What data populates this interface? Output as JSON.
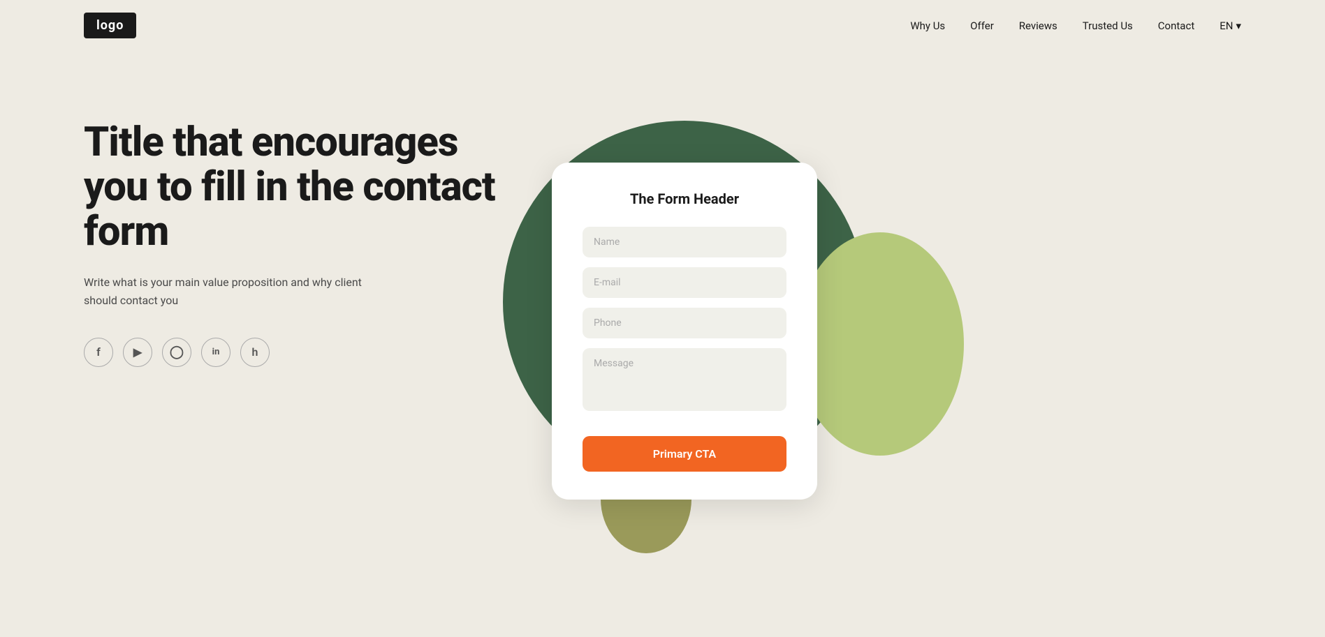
{
  "header": {
    "logo": "logo",
    "nav": {
      "items": [
        {
          "label": "Why Us",
          "href": "#"
        },
        {
          "label": "Offer",
          "href": "#"
        },
        {
          "label": "Reviews",
          "href": "#"
        },
        {
          "label": "Trusted Us",
          "href": "#"
        },
        {
          "label": "Contact",
          "href": "#"
        }
      ],
      "language": "EN",
      "language_arrow": "▾"
    }
  },
  "hero": {
    "title": "Title that encourages you to fill in the contact form",
    "subtitle": "Write what is your main value proposition and why client should contact you",
    "social_icons": [
      {
        "name": "facebook-icon",
        "symbol": "f"
      },
      {
        "name": "youtube-icon",
        "symbol": "▶"
      },
      {
        "name": "instagram-icon",
        "symbol": "◻"
      },
      {
        "name": "linkedin-icon",
        "symbol": "in"
      },
      {
        "name": "houzz-icon",
        "symbol": "h"
      }
    ]
  },
  "form": {
    "header": "The Form Header",
    "fields": {
      "name_placeholder": "Name",
      "email_placeholder": "E-mail",
      "phone_placeholder": "Phone",
      "message_placeholder": "Message"
    },
    "cta_label": "Primary CTA"
  },
  "colors": {
    "background": "#eeebe3",
    "dark_green": "#3d6347",
    "olive": "#9a9a5a",
    "light_green": "#b5c97a",
    "orange": "#f26522",
    "logo_bg": "#1a1a1a"
  }
}
